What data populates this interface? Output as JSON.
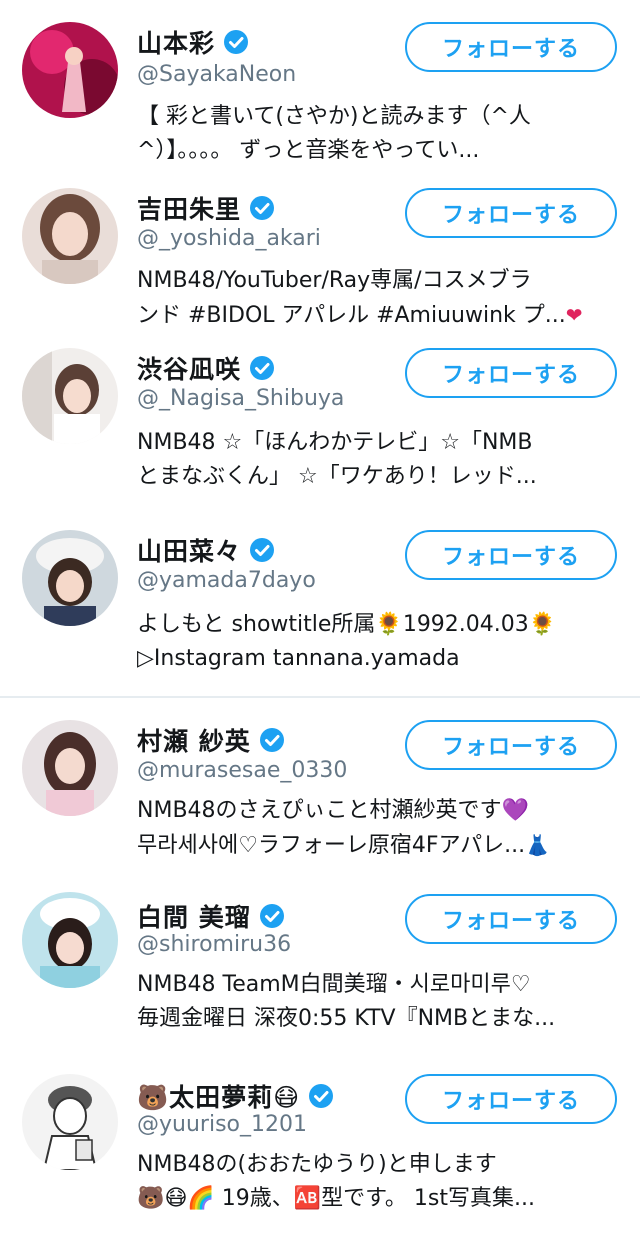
{
  "follow_label": "フォローする",
  "accent_color": "#1da1f2",
  "users": [
    {
      "name": "山本彩",
      "handle": "@SayakaNeon",
      "verified": true,
      "bio_lines": [
        "【 彩と書いて(さやか)と読みます（^人",
        "^）】。。。。 ずっと音楽をやってい..."
      ]
    },
    {
      "name": "吉田朱里",
      "handle": "@_yoshida_akari",
      "verified": true,
      "bio_lines": [
        "NMB48/YouTuber/Ray専属/コスメブラ",
        "ンド #BIDOL アパレル #Amiuuwink プ..."
      ],
      "bio_trailing_emoji": "❤"
    },
    {
      "name": "渋谷凪咲",
      "handle": "@_Nagisa_Shibuya",
      "verified": true,
      "bio_lines": [
        "NMB48 ☆「ほんわかテレビ」☆「NMB",
        "とまなぶくん」 ☆「ワケあり！レッド..."
      ]
    },
    {
      "name": "山田菜々",
      "handle": "@yamada7dayo",
      "verified": true,
      "bio_lines": [
        "よしもと showtitle所属🌻1992.04.03🌻",
        "▷Instagram tannana.yamada"
      ]
    },
    {
      "name": "村瀬 紗英",
      "handle": "@murasesae_0330",
      "verified": true,
      "bio_lines": [
        "NMB48のさえぴぃこと村瀬紗英です💜",
        "무라세사에♡ラフォーレ原宿4Fアパレ..."
      ],
      "bio_trailing_emoji": "👗"
    },
    {
      "name": "白間 美瑠",
      "handle": "@shiromiru36",
      "verified": true,
      "bio_lines": [
        "NMB48 TeamM白間美瑠・시로마미루♡",
        "毎週金曜日 深夜0:55 KTV『NMBとまな..."
      ]
    },
    {
      "name": "🐻太田夢莉😷",
      "handle": "@yuuriso_1201",
      "verified": true,
      "bio_lines": [
        "NMB48の(おおたゆうり)と申します",
        "🐻😷🌈 19歳、🆎型です。 1st写真集..."
      ]
    }
  ]
}
